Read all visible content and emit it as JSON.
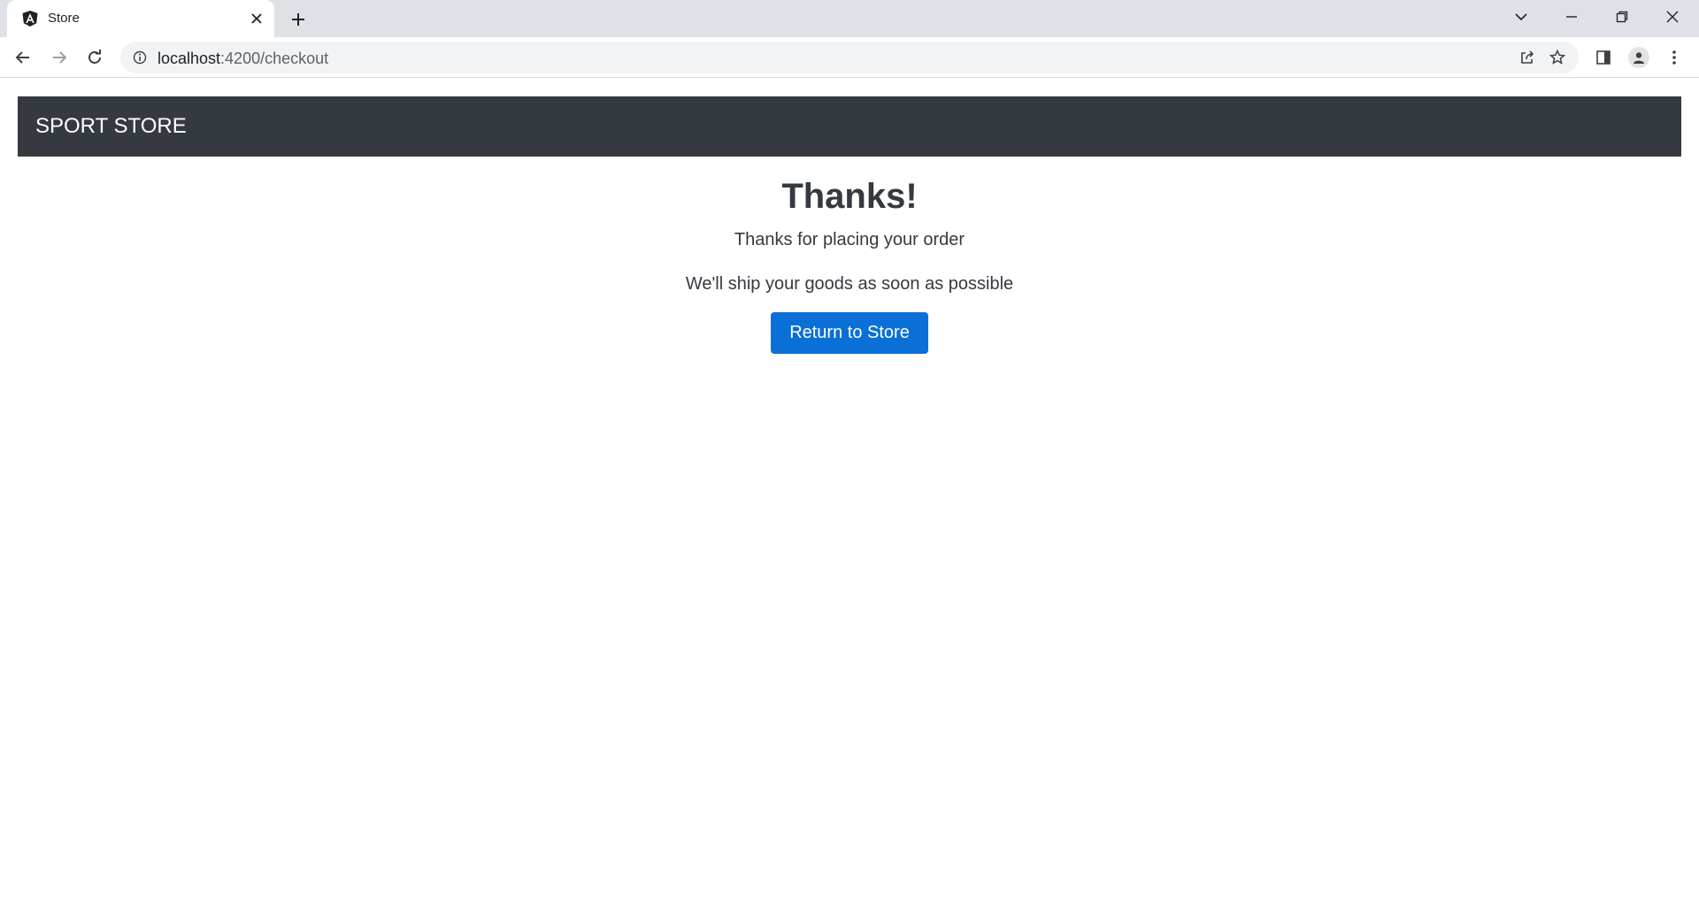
{
  "browser": {
    "tab": {
      "title": "Store",
      "favicon": "angular-icon"
    },
    "url": {
      "host": "localhost",
      "rest": ":4200/checkout"
    }
  },
  "navbar": {
    "brand": "SPORT STORE"
  },
  "main": {
    "heading": "Thanks!",
    "line1": "Thanks for placing your order",
    "line2": "We'll ship your goods as soon as possible",
    "return_button": "Return to Store"
  },
  "colors": {
    "navbar_bg": "#343a40",
    "button_bg": "#0a6fd6",
    "tabstrip_bg": "#dee1e6"
  }
}
